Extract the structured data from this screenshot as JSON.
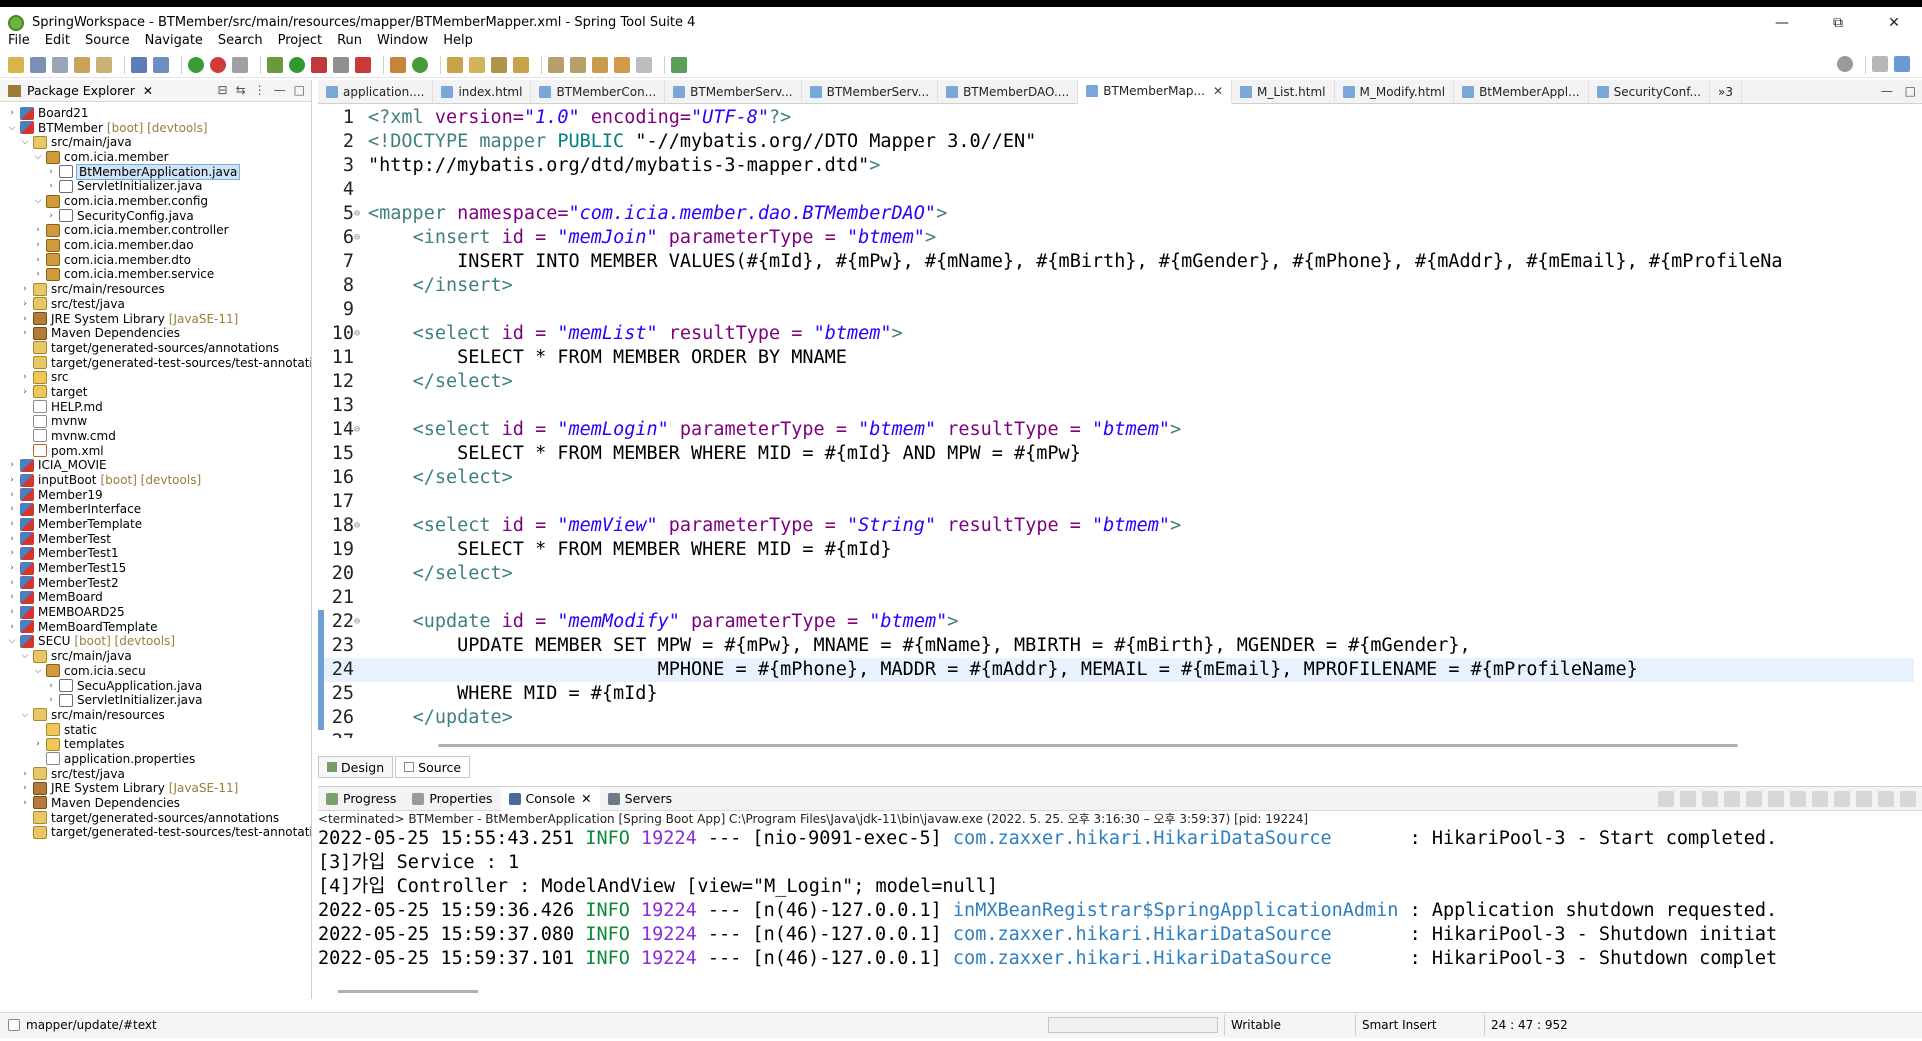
{
  "window": {
    "title": "SpringWorkspace - BTMember/src/main/resources/mapper/BTMemberMapper.xml - Spring Tool Suite 4",
    "minimize": "—",
    "maximize": "⧉",
    "close": "✕"
  },
  "menu": [
    "File",
    "Edit",
    "Source",
    "Navigate",
    "Search",
    "Project",
    "Run",
    "Window",
    "Help"
  ],
  "package_explorer": {
    "title": "Package Explorer",
    "items": [
      {
        "label": "Board21",
        "decoration": "",
        "depth": 0,
        "icon": "project-icon",
        "twisty": ">"
      },
      {
        "label": "BTMember",
        "decoration": "[boot] [devtools]",
        "depth": 0,
        "icon": "project-icon",
        "twisty": "v"
      },
      {
        "label": "src/main/java",
        "decoration": "",
        "depth": 1,
        "icon": "source-folder-icon",
        "twisty": "v"
      },
      {
        "label": "com.icia.member",
        "decoration": "",
        "depth": 2,
        "icon": "package-icon",
        "twisty": "v"
      },
      {
        "label": "BtMemberApplication.java",
        "decoration": "",
        "depth": 3,
        "icon": "java-file-icon",
        "twisty": ">",
        "selected": true
      },
      {
        "label": "ServletInitializer.java",
        "decoration": "",
        "depth": 3,
        "icon": "java-file-icon",
        "twisty": ">"
      },
      {
        "label": "com.icia.member.config",
        "decoration": "",
        "depth": 2,
        "icon": "package-icon",
        "twisty": "v"
      },
      {
        "label": "SecurityConfig.java",
        "decoration": "",
        "depth": 3,
        "icon": "java-file-icon",
        "twisty": ">"
      },
      {
        "label": "com.icia.member.controller",
        "decoration": "",
        "depth": 2,
        "icon": "package-icon",
        "twisty": ">"
      },
      {
        "label": "com.icia.member.dao",
        "decoration": "",
        "depth": 2,
        "icon": "package-icon",
        "twisty": ">"
      },
      {
        "label": "com.icia.member.dto",
        "decoration": "",
        "depth": 2,
        "icon": "package-icon",
        "twisty": ">"
      },
      {
        "label": "com.icia.member.service",
        "decoration": "",
        "depth": 2,
        "icon": "package-icon",
        "twisty": ">"
      },
      {
        "label": "src/main/resources",
        "decoration": "",
        "depth": 1,
        "icon": "source-folder-icon",
        "twisty": ">"
      },
      {
        "label": "src/test/java",
        "decoration": "",
        "depth": 1,
        "icon": "source-folder-icon",
        "twisty": ">"
      },
      {
        "label": "JRE System Library",
        "decoration": "[JavaSE-11]",
        "depth": 1,
        "icon": "library-icon",
        "twisty": ">"
      },
      {
        "label": "Maven Dependencies",
        "decoration": "",
        "depth": 1,
        "icon": "library-icon",
        "twisty": ">"
      },
      {
        "label": "target/generated-sources/annotations",
        "decoration": "",
        "depth": 1,
        "icon": "source-folder-icon",
        "twisty": ""
      },
      {
        "label": "target/generated-test-sources/test-annotatic",
        "decoration": "",
        "depth": 1,
        "icon": "source-folder-icon",
        "twisty": ""
      },
      {
        "label": "src",
        "decoration": "",
        "depth": 1,
        "icon": "folder-icon",
        "twisty": ">"
      },
      {
        "label": "target",
        "decoration": "",
        "depth": 1,
        "icon": "folder-icon",
        "twisty": ">"
      },
      {
        "label": "HELP.md",
        "decoration": "",
        "depth": 1,
        "icon": "file-icon",
        "twisty": ""
      },
      {
        "label": "mvnw",
        "decoration": "",
        "depth": 1,
        "icon": "file-icon",
        "twisty": ""
      },
      {
        "label": "mvnw.cmd",
        "decoration": "",
        "depth": 1,
        "icon": "file-icon",
        "twisty": ""
      },
      {
        "label": "pom.xml",
        "decoration": "",
        "depth": 1,
        "icon": "xml-file-icon",
        "twisty": ""
      },
      {
        "label": "ICIA_MOVIE",
        "decoration": "",
        "depth": 0,
        "icon": "project-icon",
        "twisty": ">"
      },
      {
        "label": "inputBoot",
        "decoration": "[boot] [devtools]",
        "depth": 0,
        "icon": "project-icon",
        "twisty": ">"
      },
      {
        "label": "Member19",
        "decoration": "",
        "depth": 0,
        "icon": "project-icon",
        "twisty": ">"
      },
      {
        "label": "MemberInterface",
        "decoration": "",
        "depth": 0,
        "icon": "project-icon",
        "twisty": ">"
      },
      {
        "label": "MemberTemplate",
        "decoration": "",
        "depth": 0,
        "icon": "project-icon",
        "twisty": ">"
      },
      {
        "label": "MemberTest",
        "decoration": "",
        "depth": 0,
        "icon": "project-icon",
        "twisty": ">"
      },
      {
        "label": "MemberTest1",
        "decoration": "",
        "depth": 0,
        "icon": "project-icon",
        "twisty": ">"
      },
      {
        "label": "MemberTest15",
        "decoration": "",
        "depth": 0,
        "icon": "project-icon",
        "twisty": ">"
      },
      {
        "label": "MemberTest2",
        "decoration": "",
        "depth": 0,
        "icon": "project-icon",
        "twisty": ">"
      },
      {
        "label": "MemBoard",
        "decoration": "",
        "depth": 0,
        "icon": "project-icon",
        "twisty": ">"
      },
      {
        "label": "MEMBOARD25",
        "decoration": "",
        "depth": 0,
        "icon": "project-icon",
        "twisty": ">"
      },
      {
        "label": "MemBoardTemplate",
        "decoration": "",
        "depth": 0,
        "icon": "project-icon",
        "twisty": ">"
      },
      {
        "label": "SECU",
        "decoration": "[boot] [devtools]",
        "depth": 0,
        "icon": "project-icon",
        "twisty": "v"
      },
      {
        "label": "src/main/java",
        "decoration": "",
        "depth": 1,
        "icon": "source-folder-icon",
        "twisty": "v"
      },
      {
        "label": "com.icia.secu",
        "decoration": "",
        "depth": 2,
        "icon": "package-icon",
        "twisty": "v"
      },
      {
        "label": "SecuApplication.java",
        "decoration": "",
        "depth": 3,
        "icon": "java-file-icon",
        "twisty": ">"
      },
      {
        "label": "ServletInitializer.java",
        "decoration": "",
        "depth": 3,
        "icon": "java-file-icon",
        "twisty": ">"
      },
      {
        "label": "src/main/resources",
        "decoration": "",
        "depth": 1,
        "icon": "source-folder-icon",
        "twisty": "v"
      },
      {
        "label": "static",
        "decoration": "",
        "depth": 2,
        "icon": "folder-icon",
        "twisty": ""
      },
      {
        "label": "templates",
        "decoration": "",
        "depth": 2,
        "icon": "folder-icon",
        "twisty": ">"
      },
      {
        "label": "application.properties",
        "decoration": "",
        "depth": 2,
        "icon": "file-icon",
        "twisty": ""
      },
      {
        "label": "src/test/java",
        "decoration": "",
        "depth": 1,
        "icon": "source-folder-icon",
        "twisty": ">"
      },
      {
        "label": "JRE System Library",
        "decoration": "[JavaSE-11]",
        "depth": 1,
        "icon": "library-icon",
        "twisty": ">"
      },
      {
        "label": "Maven Dependencies",
        "decoration": "",
        "depth": 1,
        "icon": "library-icon",
        "twisty": ">"
      },
      {
        "label": "target/generated-sources/annotations",
        "decoration": "",
        "depth": 1,
        "icon": "source-folder-icon",
        "twisty": ""
      },
      {
        "label": "target/generated-test-sources/test-annotatic",
        "decoration": "",
        "depth": 1,
        "icon": "source-folder-icon",
        "twisty": ""
      }
    ]
  },
  "editor_tabs": [
    {
      "label": "application....",
      "active": false
    },
    {
      "label": "index.html",
      "active": false
    },
    {
      "label": "BTMemberCon...",
      "active": false
    },
    {
      "label": "BTMemberServ...",
      "active": false
    },
    {
      "label": "BTMemberServ...",
      "active": false
    },
    {
      "label": "BTMemberDAO....",
      "active": false
    },
    {
      "label": "BTMemberMap...",
      "active": true
    },
    {
      "label": "M_List.html",
      "active": false
    },
    {
      "label": "M_Modify.html",
      "active": false
    },
    {
      "label": "BtMemberAppl...",
      "active": false
    },
    {
      "label": "SecurityConf...",
      "active": false
    }
  ],
  "editor_tabs_overflow": "»3",
  "code_lines": [
    {
      "n": "1",
      "fold": "",
      "segs": [
        [
          "tag",
          "<?xml "
        ],
        [
          "attr",
          "version="
        ],
        [
          "str",
          "\"1.0\""
        ],
        [
          "attr",
          " encoding="
        ],
        [
          "str",
          "\"UTF-8\""
        ],
        [
          "tag",
          "?>"
        ]
      ]
    },
    {
      "n": "2",
      "fold": "",
      "segs": [
        [
          "tag",
          "<!DOCTYPE mapper "
        ],
        [
          "dtd",
          "PUBLIC "
        ],
        [
          "plain",
          "\"-//mybatis.org//DTO Mapper 3.0//EN\""
        ]
      ]
    },
    {
      "n": "3",
      "fold": "",
      "segs": [
        [
          "plain",
          "\"http://mybatis.org/dtd/mybatis-3-mapper.dtd\""
        ],
        [
          "tag",
          ">"
        ]
      ]
    },
    {
      "n": "4",
      "fold": "",
      "segs": []
    },
    {
      "n": "5",
      "fold": "⊖",
      "segs": [
        [
          "tag",
          "<mapper "
        ],
        [
          "attr",
          "namespace="
        ],
        [
          "str",
          "\"com.icia.member.dao.BTMemberDAO\""
        ],
        [
          "tag",
          ">"
        ]
      ]
    },
    {
      "n": "6",
      "fold": "⊖",
      "segs": [
        [
          "plain",
          "    "
        ],
        [
          "tag",
          "<insert "
        ],
        [
          "attr",
          "id = "
        ],
        [
          "str",
          "\"memJoin\""
        ],
        [
          "attr",
          " parameterType = "
        ],
        [
          "str",
          "\"btmem\""
        ],
        [
          "tag",
          ">"
        ]
      ]
    },
    {
      "n": "7",
      "fold": "",
      "segs": [
        [
          "plain",
          "        INSERT INTO MEMBER VALUES(#{mId}, #{mPw}, #{mName}, #{mBirth}, #{mGender}, #{mPhone}, #{mAddr}, #{mEmail}, #{mProfileNa"
        ]
      ]
    },
    {
      "n": "8",
      "fold": "",
      "segs": [
        [
          "plain",
          "    "
        ],
        [
          "tag",
          "</insert>"
        ]
      ]
    },
    {
      "n": "9",
      "fold": "",
      "segs": []
    },
    {
      "n": "10",
      "fold": "⊖",
      "segs": [
        [
          "plain",
          "    "
        ],
        [
          "tag",
          "<select "
        ],
        [
          "attr",
          "id = "
        ],
        [
          "str",
          "\"memList\""
        ],
        [
          "attr",
          " resultType = "
        ],
        [
          "str",
          "\"btmem\""
        ],
        [
          "tag",
          ">"
        ]
      ]
    },
    {
      "n": "11",
      "fold": "",
      "segs": [
        [
          "plain",
          "        SELECT * FROM MEMBER ORDER BY MNAME"
        ]
      ]
    },
    {
      "n": "12",
      "fold": "",
      "segs": [
        [
          "plain",
          "    "
        ],
        [
          "tag",
          "</select>"
        ]
      ]
    },
    {
      "n": "13",
      "fold": "",
      "segs": []
    },
    {
      "n": "14",
      "fold": "⊖",
      "segs": [
        [
          "plain",
          "    "
        ],
        [
          "tag",
          "<select "
        ],
        [
          "attr",
          "id = "
        ],
        [
          "str",
          "\"memLogin\""
        ],
        [
          "attr",
          " parameterType = "
        ],
        [
          "str",
          "\"btmem\""
        ],
        [
          "attr",
          " resultType = "
        ],
        [
          "str",
          "\"btmem\""
        ],
        [
          "tag",
          ">"
        ]
      ]
    },
    {
      "n": "15",
      "fold": "",
      "segs": [
        [
          "plain",
          "        SELECT * FROM MEMBER WHERE MID = #{mId} AND MPW = #{mPw}"
        ]
      ]
    },
    {
      "n": "16",
      "fold": "",
      "segs": [
        [
          "plain",
          "    "
        ],
        [
          "tag",
          "</select>"
        ]
      ]
    },
    {
      "n": "17",
      "fold": "",
      "segs": []
    },
    {
      "n": "18",
      "fold": "⊖",
      "segs": [
        [
          "plain",
          "    "
        ],
        [
          "tag",
          "<select "
        ],
        [
          "attr",
          "id = "
        ],
        [
          "str",
          "\"memView\""
        ],
        [
          "attr",
          " parameterType = "
        ],
        [
          "str",
          "\"String\""
        ],
        [
          "attr",
          " resultType = "
        ],
        [
          "str",
          "\"btmem\""
        ],
        [
          "tag",
          ">"
        ]
      ]
    },
    {
      "n": "19",
      "fold": "",
      "segs": [
        [
          "plain",
          "        SELECT * FROM MEMBER WHERE MID = #{mId}"
        ]
      ]
    },
    {
      "n": "20",
      "fold": "",
      "segs": [
        [
          "plain",
          "    "
        ],
        [
          "tag",
          "</select>"
        ]
      ]
    },
    {
      "n": "21",
      "fold": "",
      "segs": []
    },
    {
      "n": "22",
      "fold": "⊖",
      "segs": [
        [
          "plain",
          "    "
        ],
        [
          "tag",
          "<update "
        ],
        [
          "attr",
          "id = "
        ],
        [
          "str",
          "\"memModify\""
        ],
        [
          "attr",
          " parameterType = "
        ],
        [
          "str",
          "\"btmem\""
        ],
        [
          "tag",
          ">"
        ]
      ]
    },
    {
      "n": "23",
      "fold": "",
      "segs": [
        [
          "plain",
          "        UPDATE MEMBER SET MPW = #{mPw}, MNAME = #{mName}, MBIRTH = #{mBirth}, MGENDER = #{mGender},"
        ]
      ]
    },
    {
      "n": "24",
      "fold": "",
      "segs": [
        [
          "plain",
          "                          MPHONE = #{mPhone}, MADDR = #{mAddr}, MEMAIL = #{mEmail}, MPROFILENAME = #{mProfileName}"
        ]
      ],
      "current": true
    },
    {
      "n": "25",
      "fold": "",
      "segs": [
        [
          "plain",
          "        WHERE MID = #{mId}"
        ]
      ]
    },
    {
      "n": "26",
      "fold": "",
      "segs": [
        [
          "plain",
          "    "
        ],
        [
          "tag",
          "</update>"
        ]
      ]
    },
    {
      "n": "27",
      "fold": "",
      "segs": []
    }
  ],
  "editor_mode_tabs": [
    {
      "label": "Design",
      "active": false
    },
    {
      "label": "Source",
      "active": true
    }
  ],
  "console": {
    "tabs": [
      {
        "label": "Progress",
        "active": false,
        "closable": false
      },
      {
        "label": "Properties",
        "active": false,
        "closable": false
      },
      {
        "label": "Console",
        "active": true,
        "closable": true
      },
      {
        "label": "Servers",
        "active": false,
        "closable": false
      }
    ],
    "terminated_line": "<terminated> BTMember - BtMemberApplication [Spring Boot App] C:\\Program Files\\Java\\jdk-11\\bin\\javaw.exe  (2022. 5. 25. 오후 3:16:30 – 오후 3:59:37) [pid: 19224]",
    "lines": [
      {
        "ts": "2022-05-25 15:55:43.251",
        "level": "INFO",
        "pid": "19224",
        "thread": "--- [nio-9091-exec-5]",
        "logger": "com.zaxxer.hikari.HikariDataSource      ",
        "msg": " : HikariPool-3 - Start completed."
      },
      {
        "plain": "[3]가입 Service : 1"
      },
      {
        "plain": "[4]가입 Controller : ModelAndView [view=\"M_Login\"; model=null]"
      },
      {
        "ts": "2022-05-25 15:59:36.426",
        "level": "INFO",
        "pid": "19224",
        "thread": "--- [n(46)-127.0.0.1]",
        "logger": "inMXBeanRegistrar$SpringApplicationAdmin",
        "msg": " : Application shutdown requested."
      },
      {
        "ts": "2022-05-25 15:59:37.080",
        "level": "INFO",
        "pid": "19224",
        "thread": "--- [n(46)-127.0.0.1]",
        "logger": "com.zaxxer.hikari.HikariDataSource      ",
        "msg": " : HikariPool-3 - Shutdown initiat"
      },
      {
        "ts": "2022-05-25 15:59:37.101",
        "level": "INFO",
        "pid": "19224",
        "thread": "--- [n(46)-127.0.0.1]",
        "logger": "com.zaxxer.hikari.HikariDataSource      ",
        "msg": " : HikariPool-3 - Shutdown complet"
      }
    ]
  },
  "status_bar": {
    "path": "mapper/update/#text",
    "writable": "Writable",
    "insert_mode": "Smart Insert",
    "position": "24 : 47 : 952"
  },
  "colors": {
    "tag": "#3f7f7f",
    "attr": "#7f007f",
    "string": "#2a00ff",
    "info": "#0a8a3a",
    "logger": "#2e7fbf",
    "current_line": "#e8f2fe"
  }
}
